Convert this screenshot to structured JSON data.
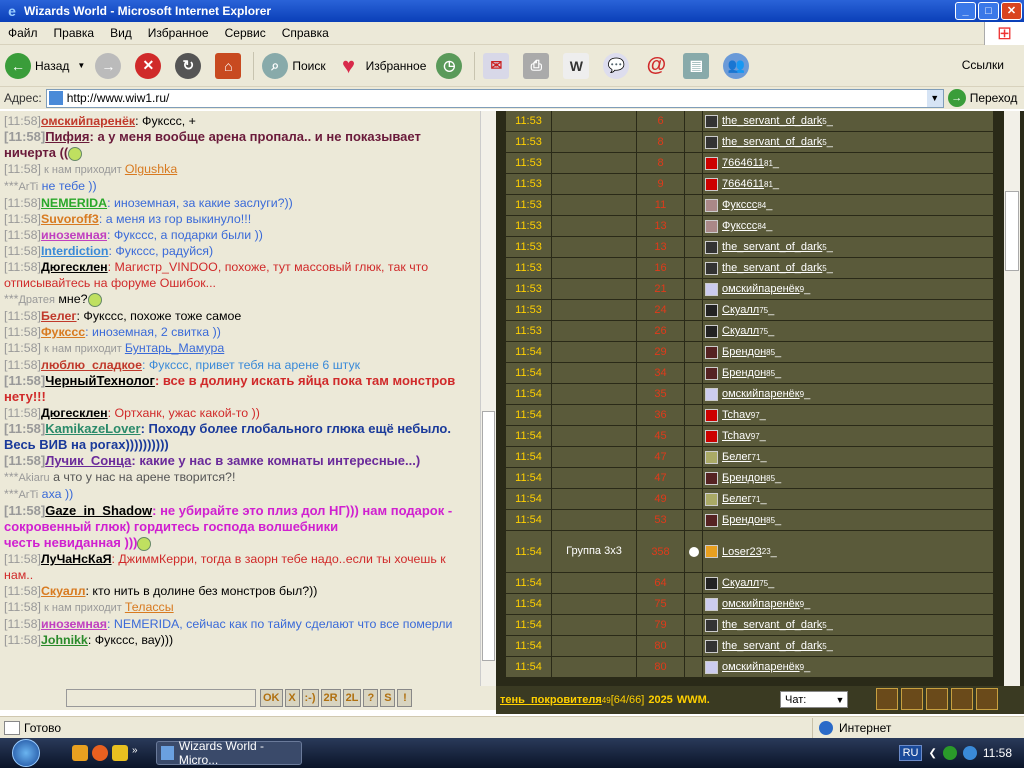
{
  "window": {
    "title": "Wizards World - Microsoft Internet Explorer",
    "min": "_",
    "max": "□",
    "close": "✕"
  },
  "menu": [
    "Файл",
    "Правка",
    "Вид",
    "Избранное",
    "Сервис",
    "Справка"
  ],
  "toolbar": {
    "back": "Назад",
    "search": "Поиск",
    "favorites": "Избранное",
    "links": "Ссылки"
  },
  "address": {
    "label": "Адрес:",
    "url": "http://www.wiw1.ru/",
    "go": "Переход"
  },
  "chat": {
    "lines": [
      {
        "time": "[11:58]",
        "user": "омскийпаренёк",
        "ucolor": "#c0392b",
        "text": ": Фукссс, +",
        "tcolor": "#000",
        "big": false
      },
      {
        "time": "[11:58]",
        "user": "Пифия",
        "ucolor": "#6a1a3a",
        "text": ": а у меня вообще арена пропала.. и не показывает ничерта ((",
        "tcolor": "#6a1a3a",
        "big": true,
        "smile": true
      },
      {
        "time": "[11:58]",
        "sys": "к нам приходит",
        "user": "Olgushka",
        "ucolor": "#d87a20",
        "type": "arrive"
      },
      {
        "time": "***",
        "sys": "ArTi",
        "text": " не тебе ))",
        "tcolor": "#3a6ad8",
        "type": "priv"
      },
      {
        "time": "[11:58]",
        "user": "NEMERIDA",
        "ucolor": "#2aa82a",
        "text": ": иноземная, за какие заслуги?))",
        "tcolor": "#3a6ad8"
      },
      {
        "time": "[11:58]",
        "user": "Suvoroff3",
        "ucolor": "#d87a20",
        "text": ": а меня из гор выкинуло!!!",
        "tcolor": "#3a6ad8"
      },
      {
        "time": "[11:58]",
        "user": "иноземная",
        "ucolor": "#c040c0",
        "text": ": Фукссс, а подарки были ))",
        "tcolor": "#3a6ad8"
      },
      {
        "time": "[11:58]",
        "user": "Interdiction",
        "ucolor": "#3a8ad8",
        "text": ": Фукссс, радуйся)",
        "tcolor": "#3a6ad8"
      },
      {
        "time": "[11:58]",
        "user": "Дюгесклен",
        "ucolor": "#000",
        "text": ": Магистр_VINDOO, похоже, тут массовый глюк, так что отписывайтесь на форуме Ошибок...",
        "tcolor": "#d02a2a"
      },
      {
        "time": "***",
        "sys": "Дратея",
        "text": " мне?",
        "tcolor": "#000",
        "type": "priv",
        "smile": true
      },
      {
        "time": "[11:58]",
        "user": "Белег",
        "ucolor": "#c0392b",
        "text": ": Фукссс, похоже тоже самое",
        "tcolor": "#000"
      },
      {
        "time": "[11:58]",
        "user": "Фукссс",
        "ucolor": "#d87a20",
        "text": ": иноземная, 2 свитка ))",
        "tcolor": "#3a6ad8"
      },
      {
        "time": "[11:58]",
        "sys": "к нам приходит",
        "user": "Бунтарь_Мамура",
        "ucolor": "#3a6ad8",
        "type": "arrive"
      },
      {
        "time": "[11:58]",
        "user": "люблю_сладкое",
        "ucolor": "#c0392b",
        "text": ": Фукссс, привет тебя на арене 6 штук",
        "tcolor": "#3a8ad8"
      },
      {
        "time": "[11:58]",
        "user": "ЧерныйТехнолог",
        "ucolor": "#000",
        "text": ": все в долину искать яйца пока там монстров нету!!!",
        "tcolor": "#d02a2a",
        "big": true
      },
      {
        "time": "[11:58]",
        "user": "Дюгесклен",
        "ucolor": "#000",
        "text": ": Ортханк, ужас какой-то ))",
        "tcolor": "#d02a2a"
      },
      {
        "time": "[11:58]",
        "user": "KamikazeLover",
        "ucolor": "#2a8a6a",
        "text": ": Походу более глобального глюка ещё небыло. Весь ВИВ на рогах))))))))))",
        "tcolor": "#1a3a9a",
        "big": true
      },
      {
        "time": "[11:58]",
        "user": "Лучик_Сонца",
        "ucolor": "#6a2a9a",
        "text": ": какие у нас в замке комнаты интересные...)",
        "tcolor": "#6a2a9a",
        "big": true
      },
      {
        "time": "***",
        "sys": "Akiaru",
        "text": " а что у нас на арене творится?!",
        "tcolor": "#555",
        "type": "priv"
      },
      {
        "time": "***",
        "sys": "ArTi",
        "text": " аха ))",
        "tcolor": "#3a6ad8",
        "type": "priv"
      },
      {
        "time": "[11:58]",
        "user": "Gaze_in_Shadow",
        "ucolor": "#000",
        "text": ": не убирайте это плиз дол НГ))) нам подарок - сокровенный глюк) гордитесь господа волшебники",
        "tcolor": "#d020d0",
        "big": true
      },
      {
        "time": "",
        "text": "честь невиданная )))",
        "tcolor": "#d020d0",
        "big": true,
        "cont": true,
        "smile": true
      },
      {
        "time": "[11:58]",
        "user": "ЛуЧаНсКаЯ",
        "ucolor": "#000",
        "text": ": ДжиммКерри, тогда в заорн тебе надо..если ты хочешь к нам..",
        "tcolor": "#d02a2a"
      },
      {
        "time": "[11:58]",
        "user": "Скуалл",
        "ucolor": "#d87a20",
        "text": ": кто нить в долине без монстров был?))",
        "tcolor": "#000"
      },
      {
        "time": "[11:58]",
        "sys": "к нам приходит",
        "user": "Телассы",
        "ucolor": "#d87a20",
        "type": "arrive"
      },
      {
        "time": "[11:58]",
        "user": "иноземная",
        "ucolor": "#c040c0",
        "text": ": NEMERIDA, сейчас как по тайму сделают что все померли",
        "tcolor": "#3a6ad8"
      },
      {
        "time": "[11:58]",
        "user": "Johnikk",
        "ucolor": "#2a8a2a",
        "text": ": Фукссс, вау)))",
        "tcolor": "#000"
      }
    ],
    "buttons": [
      "OK",
      "X",
      ":-)",
      "2R",
      "2L",
      "?",
      "S",
      "!"
    ]
  },
  "battle": {
    "rows": [
      {
        "time": "11:53",
        "n": "6",
        "name": "the_servant_of_dark",
        "lvl": "5",
        "ico": "#333"
      },
      {
        "time": "11:53",
        "n": "8",
        "name": "the_servant_of_dark",
        "lvl": "5",
        "ico": "#333"
      },
      {
        "time": "11:53",
        "n": "8",
        "name": "7664611",
        "lvl": "81",
        "ico": "#c00"
      },
      {
        "time": "11:53",
        "n": "9",
        "name": "7664611",
        "lvl": "81",
        "ico": "#c00"
      },
      {
        "time": "11:53",
        "n": "11",
        "name": "Фукссс",
        "lvl": "84",
        "ico": "#a88"
      },
      {
        "time": "11:53",
        "n": "13",
        "name": "Фукссс",
        "lvl": "84",
        "ico": "#a88"
      },
      {
        "time": "11:53",
        "n": "13",
        "name": "the_servant_of_dark",
        "lvl": "5",
        "ico": "#333"
      },
      {
        "time": "11:53",
        "n": "16",
        "name": "the_servant_of_dark",
        "lvl": "5",
        "ico": "#333"
      },
      {
        "time": "11:53",
        "n": "21",
        "name": "омскийпаренёк",
        "lvl": "9",
        "ico": "#cce"
      },
      {
        "time": "11:53",
        "n": "24",
        "name": "Скуалл",
        "lvl": "75",
        "ico": "#222"
      },
      {
        "time": "11:53",
        "n": "26",
        "name": "Скуалл",
        "lvl": "75",
        "ico": "#222"
      },
      {
        "time": "11:54",
        "n": "29",
        "name": "Брендон",
        "lvl": "85",
        "ico": "#522"
      },
      {
        "time": "11:54",
        "n": "34",
        "name": "Брендон",
        "lvl": "85",
        "ico": "#522"
      },
      {
        "time": "11:54",
        "n": "35",
        "name": "омскийпаренёк",
        "lvl": "9",
        "ico": "#cce"
      },
      {
        "time": "11:54",
        "n": "36",
        "name": "Tchav",
        "lvl": "97",
        "ico": "#c00"
      },
      {
        "time": "11:54",
        "n": "45",
        "name": "Tchav",
        "lvl": "97",
        "ico": "#c00"
      },
      {
        "time": "11:54",
        "n": "47",
        "name": "Белег",
        "lvl": "71",
        "ico": "#aa6"
      },
      {
        "time": "11:54",
        "n": "47",
        "name": "Брендон",
        "lvl": "85",
        "ico": "#522"
      },
      {
        "time": "11:54",
        "n": "49",
        "name": "Белег",
        "lvl": "71",
        "ico": "#aa6"
      },
      {
        "time": "11:54",
        "n": "53",
        "name": "Брендон",
        "lvl": "85",
        "ico": "#522"
      },
      {
        "time": "11:54",
        "group": "Группа 3х3",
        "n": "358",
        "name": "Loser23",
        "lvl": "23",
        "ico": "#e8a020",
        "tall": true
      },
      {
        "time": "11:54",
        "n": "64",
        "name": "Скуалл",
        "lvl": "75",
        "ico": "#222"
      },
      {
        "time": "11:54",
        "n": "75",
        "name": "омскийпаренёк",
        "lvl": "9",
        "ico": "#cce"
      },
      {
        "time": "11:54",
        "n": "79",
        "name": "the_servant_of_dark",
        "lvl": "5",
        "ico": "#333"
      },
      {
        "time": "11:54",
        "n": "80",
        "name": "the_servant_of_dark",
        "lvl": "5",
        "ico": "#333"
      },
      {
        "time": "11:54",
        "n": "80",
        "name": "омскийпаренёк",
        "lvl": "9",
        "ico": "#cce"
      }
    ]
  },
  "game_status": {
    "name": "тень_покровителя",
    "lvl": "49",
    "hp": "[64/66]",
    "money": "2025",
    "wwm": "WWM.",
    "chat_sel": "Чат:"
  },
  "statusbar": {
    "status": "Готово",
    "zone": "Интернет"
  },
  "taskbar": {
    "task": "Wizards World - Micro...",
    "lang": "RU",
    "clock": "11:58"
  }
}
